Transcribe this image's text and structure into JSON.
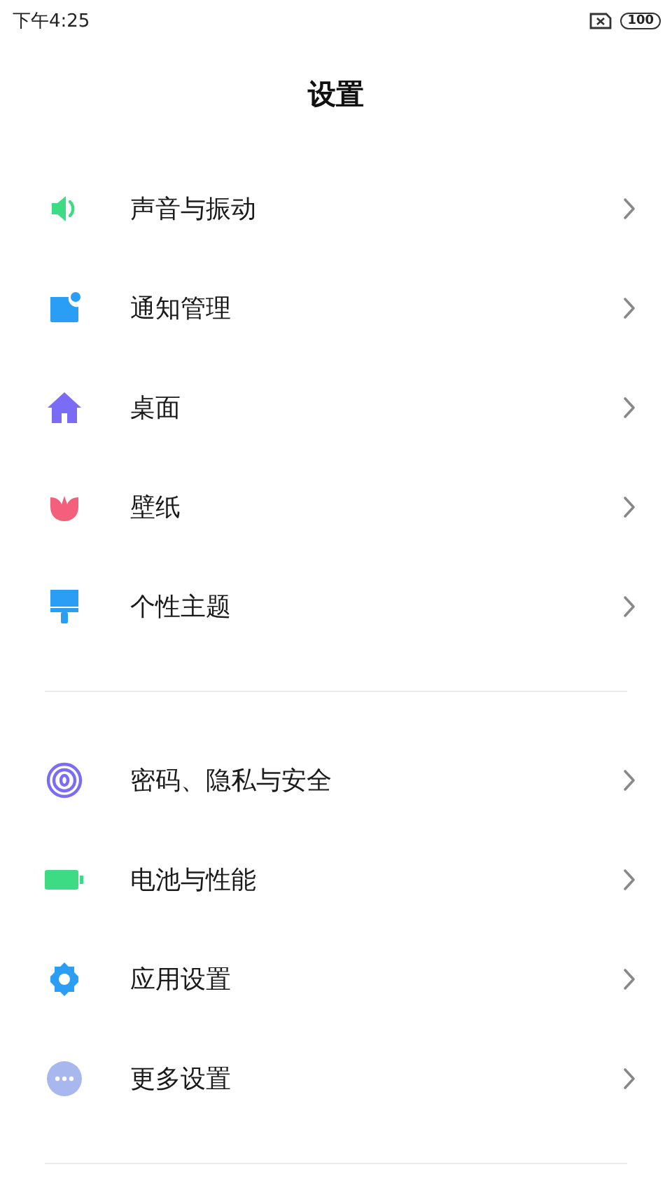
{
  "status_bar": {
    "time": "下午4:25",
    "battery": "100"
  },
  "title": "设置",
  "groups": [
    {
      "items": [
        {
          "kind": "sound",
          "label": "声音与振动"
        },
        {
          "kind": "notification",
          "label": "通知管理"
        },
        {
          "kind": "home",
          "label": "桌面"
        },
        {
          "kind": "wallpaper",
          "label": "壁纸"
        },
        {
          "kind": "theme",
          "label": "个性主题"
        }
      ]
    },
    {
      "items": [
        {
          "kind": "privacy",
          "label": "密码、隐私与安全"
        },
        {
          "kind": "battery",
          "label": "电池与性能"
        },
        {
          "kind": "apps",
          "label": "应用设置"
        },
        {
          "kind": "more",
          "label": "更多设置"
        }
      ]
    }
  ]
}
